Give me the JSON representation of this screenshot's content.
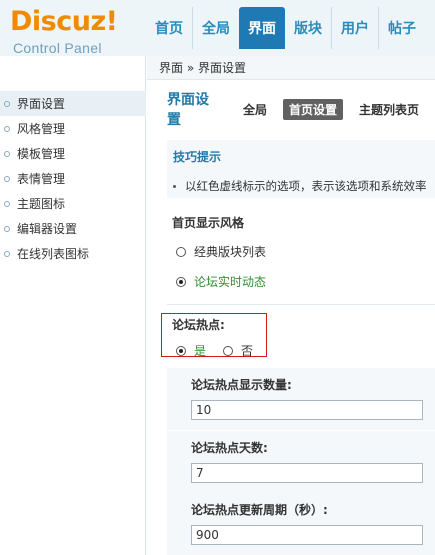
{
  "logo": {
    "main": "Discuz!",
    "sub": "Control Panel"
  },
  "nav": [
    {
      "label": "首页",
      "active": false
    },
    {
      "label": "全局",
      "active": false
    },
    {
      "label": "界面",
      "active": true
    },
    {
      "label": "版块",
      "active": false
    },
    {
      "label": "用户",
      "active": false
    },
    {
      "label": "帖子",
      "active": false
    }
  ],
  "sidebar": {
    "items": [
      {
        "label": "界面设置"
      },
      {
        "label": "风格管理"
      },
      {
        "label": "模板管理"
      },
      {
        "label": "表情管理"
      },
      {
        "label": "主题图标"
      },
      {
        "label": "编辑器设置"
      },
      {
        "label": "在线列表图标"
      }
    ]
  },
  "breadcrumb": "界面 » 界面设置",
  "page": {
    "title": "界面设置",
    "subtabs": [
      "全局",
      "首页设置",
      "主题列表页"
    ]
  },
  "tips": {
    "title": "技巧提示",
    "text": "以红色虚线标示的选项，表示该选项和系统效率"
  },
  "homepage_style": {
    "label": "首页显示风格",
    "options": [
      "经典版块列表",
      "论坛实时动态"
    ],
    "selected": "论坛实时动态"
  },
  "hot": {
    "label": "论坛热点:",
    "yes": "是",
    "no": "否",
    "selected": "是"
  },
  "hot_settings": [
    {
      "label": "论坛热点显示数量:",
      "value": "10"
    },
    {
      "label": "论坛热点天数:",
      "value": "7"
    },
    {
      "label": "论坛热点更新周期（秒）:",
      "value": "900"
    }
  ],
  "colors": {
    "accent": "#1f7ab3",
    "logo": "#f08a00",
    "highlight_border": "#d21c1c",
    "selected_text": "#2f8f2f"
  }
}
